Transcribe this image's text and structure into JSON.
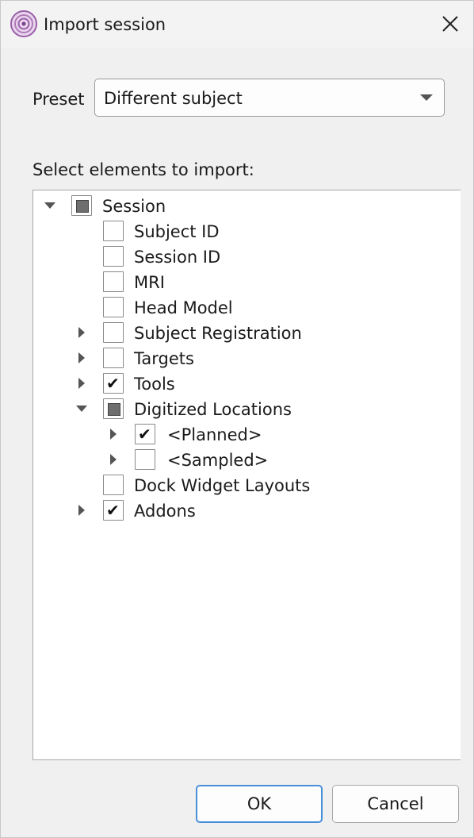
{
  "window": {
    "title": "Import session",
    "icon": "target-rings-icon",
    "close_icon": "close-x-icon"
  },
  "preset": {
    "label": "Preset",
    "value": "Different subject"
  },
  "tree": {
    "heading": "Select elements to import:",
    "items": [
      {
        "label": "Session",
        "state": "partial",
        "expander": "expanded",
        "level": 0
      },
      {
        "label": "Subject ID",
        "state": "unchecked",
        "expander": "none",
        "level": 1
      },
      {
        "label": "Session ID",
        "state": "unchecked",
        "expander": "none",
        "level": 1
      },
      {
        "label": "MRI",
        "state": "unchecked",
        "expander": "none",
        "level": 1
      },
      {
        "label": "Head Model",
        "state": "unchecked",
        "expander": "none",
        "level": 1
      },
      {
        "label": "Subject Registration",
        "state": "unchecked",
        "expander": "collapsed",
        "level": 1
      },
      {
        "label": "Targets",
        "state": "unchecked",
        "expander": "collapsed",
        "level": 1
      },
      {
        "label": "Tools",
        "state": "checked",
        "expander": "collapsed",
        "level": 1
      },
      {
        "label": "Digitized Locations",
        "state": "partial",
        "expander": "expanded",
        "level": 1
      },
      {
        "label": "<Planned>",
        "state": "checked",
        "expander": "collapsed",
        "level": 2
      },
      {
        "label": "<Sampled>",
        "state": "unchecked",
        "expander": "collapsed",
        "level": 2
      },
      {
        "label": "Dock Widget Layouts",
        "state": "unchecked",
        "expander": "none",
        "level": 1
      },
      {
        "label": "Addons",
        "state": "checked",
        "expander": "collapsed",
        "level": 1
      }
    ]
  },
  "buttons": {
    "ok": "OK",
    "cancel": "Cancel"
  },
  "colors": {
    "background": "#f0f0f0",
    "default_button_border": "#4a8fd9",
    "icon_purple": "#9b5ea8"
  }
}
